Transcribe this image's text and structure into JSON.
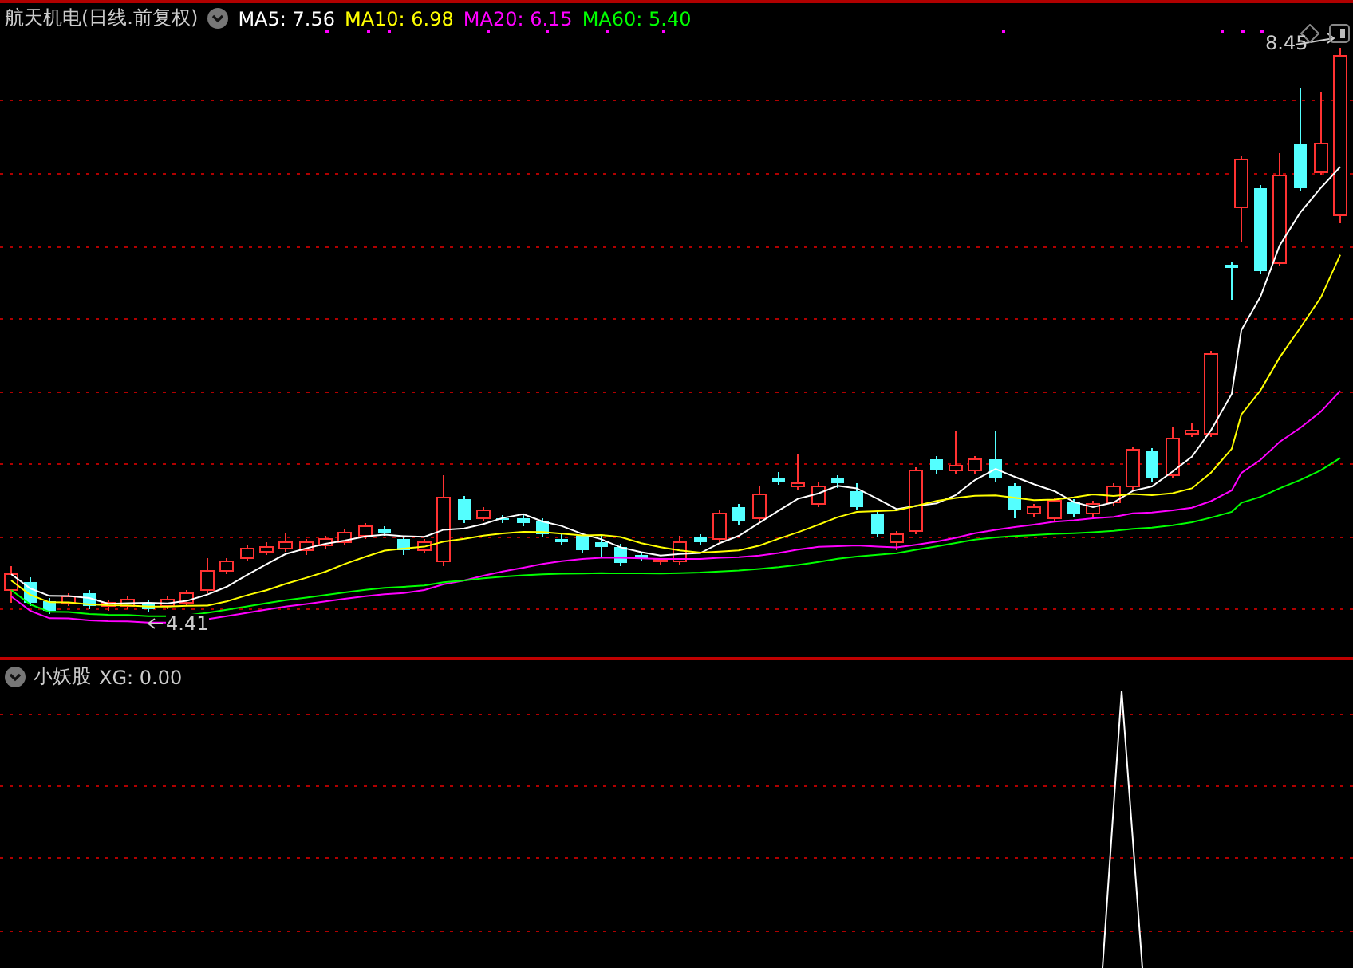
{
  "header": {
    "stock_name": "航天机电",
    "mode": "(日线.前复权)",
    "moving_averages": [
      {
        "label": "MA5:",
        "value": "7.56",
        "color": "#ffffff"
      },
      {
        "label": "MA10:",
        "value": "6.98",
        "color": "#ffff00"
      },
      {
        "label": "MA20:",
        "value": "6.15",
        "color": "#ff00ff"
      },
      {
        "label": "MA60:",
        "value": "5.40",
        "color": "#00ff00"
      }
    ]
  },
  "price_chart": {
    "high_label": "8.45",
    "low_label": "4.41"
  },
  "indicator": {
    "name": "小妖股",
    "reading": "XG: 0.00"
  }
}
